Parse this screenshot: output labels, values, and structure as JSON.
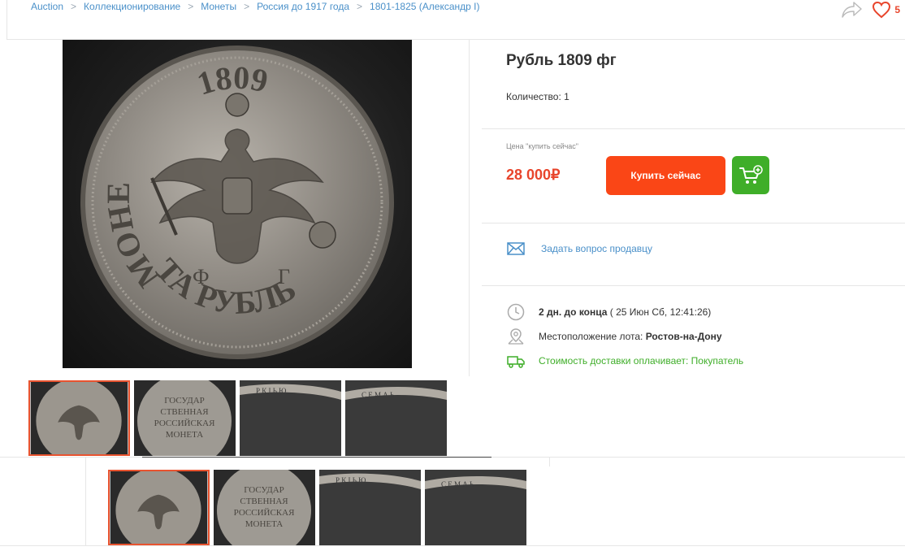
{
  "breadcrumb": [
    "Auction",
    "Коллекционирование",
    "Монеты",
    "Россия до 1917 года",
    "1801-1825 (Александр I)"
  ],
  "favorites_count": "5",
  "lot": {
    "title": "Рубль 1809 фг",
    "quantity": "Количество: 1",
    "price_label": "Цена \"купить сейчас\"",
    "price": "28 000₽",
    "buy_label": "Купить сейчас",
    "ask_label": "Задать вопрос продавцу",
    "time_left": "2 дн. до конца",
    "end_time": " ( 25 Июн Сб, 12:41:26)",
    "location_label": "Местоположение лота: ",
    "location_value": "Ростов-на-Дону",
    "delivery": "Стоимость доставки оплачивает: Покупатель"
  },
  "coin_obverse": {
    "top_text": "1809",
    "left_text": "МОНЕ",
    "bottom_text": "ТА РУБЛЬ",
    "mint_marks": [
      "Ф",
      "Г"
    ]
  },
  "coin_reverse": {
    "lines": [
      "ГОСУДАР",
      "СТВЕННАЯ",
      "РОССИЙСКАЯ",
      "МОНЕТА"
    ]
  },
  "coin_edges": {
    "edge1": "Р К І Ь Ю",
    "edge2": "С Е М А Ь"
  },
  "colors": {
    "accent": "#fa4616",
    "cart": "#3fae29",
    "link": "#4a90c9",
    "price": "#e8452c"
  }
}
